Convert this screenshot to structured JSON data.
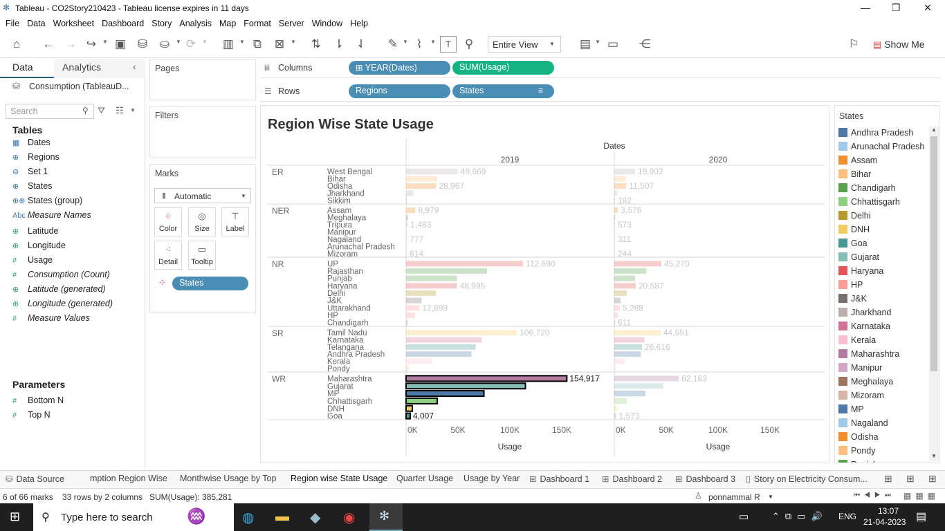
{
  "window": {
    "title": "Tableau - CO2Story210423 - Tableau license expires in 11 days",
    "min": "—",
    "max": "❐",
    "close": "✕"
  },
  "menu": [
    "File",
    "Data",
    "Worksheet",
    "Dashboard",
    "Story",
    "Analysis",
    "Map",
    "Format",
    "Server",
    "Window",
    "Help"
  ],
  "toolbar": {
    "view_select": "Entire View",
    "show_me": "Show Me"
  },
  "left": {
    "tab_data": "Data",
    "tab_analytics": "Analytics",
    "datasource": "Consumption (TableauD...",
    "search_placeholder": "Search",
    "tables_header": "Tables",
    "fields": [
      {
        "icon": "cal",
        "name": "Dates",
        "kind": "dim"
      },
      {
        "icon": "globe",
        "name": "Regions",
        "kind": "dim"
      },
      {
        "icon": "set",
        "name": "Set 1",
        "kind": "dim"
      },
      {
        "icon": "globe",
        "name": "States",
        "kind": "dim"
      },
      {
        "icon": "group",
        "name": "States (group)",
        "kind": "dim"
      },
      {
        "icon": "Abc",
        "name": "Measure Names",
        "kind": "it"
      },
      {
        "icon": "globe",
        "name": "Latitude",
        "kind": "mea"
      },
      {
        "icon": "globe",
        "name": "Longitude",
        "kind": "mea"
      },
      {
        "icon": "#",
        "name": "Usage",
        "kind": "mea"
      },
      {
        "icon": "#",
        "name": "Consumption (Count)",
        "kind": "mea-it"
      },
      {
        "icon": "globe",
        "name": "Latitude (generated)",
        "kind": "mea-it"
      },
      {
        "icon": "globe",
        "name": "Longitude (generated)",
        "kind": "mea-it"
      },
      {
        "icon": "#",
        "name": "Measure Values",
        "kind": "mea-it"
      }
    ],
    "parameters_header": "Parameters",
    "parameters": [
      "Bottom N",
      "Top N"
    ]
  },
  "cards": {
    "pages": "Pages",
    "filters": "Filters",
    "marks": "Marks",
    "mark_type": "Automatic",
    "buttons": [
      "Color",
      "Size",
      "Label",
      "Detail",
      "Tooltip"
    ],
    "color_pill": "States"
  },
  "shelves": {
    "columns_label": "Columns",
    "rows_label": "Rows",
    "columns": [
      "YEAR(Dates)",
      "SUM(Usage)"
    ],
    "rows": [
      "Regions",
      "States"
    ]
  },
  "chart_data": {
    "type": "bar",
    "title": "Region Wise State Usage",
    "column_header": "Dates",
    "panes": [
      "2019",
      "2020"
    ],
    "xlabel": "Usage",
    "xlim": [
      0,
      200000
    ],
    "x_ticks": [
      "0K",
      "50K",
      "100K",
      "150K"
    ],
    "regions": [
      {
        "name": "ER",
        "states": [
          {
            "state": "West Bengal",
            "v2019": 49869,
            "v2020": 19902,
            "l2019": "49,869",
            "l2020": "19,902"
          },
          {
            "state": "Bihar",
            "v2019": 30000,
            "v2020": 11000
          },
          {
            "state": "Odisha",
            "v2019": 28967,
            "v2020": 11507,
            "l2019": "28,967",
            "l2020": "11,507"
          },
          {
            "state": "Jharkhand",
            "v2019": 7000,
            "v2020": 2500
          },
          {
            "state": "Sikkim",
            "v2019": 500,
            "v2020": 182,
            "l2020": "182"
          }
        ]
      },
      {
        "name": "NER",
        "states": [
          {
            "state": "Assam",
            "v2019": 8979,
            "v2020": 3576,
            "l2019": "8,979",
            "l2020": "3,576"
          },
          {
            "state": "Meghalaya",
            "v2019": 1800,
            "v2020": 700
          },
          {
            "state": "Tripura",
            "v2019": 1483,
            "v2020": 573,
            "l2019": "1,483",
            "l2020": "573"
          },
          {
            "state": "Manipur",
            "v2019": 900,
            "v2020": 350
          },
          {
            "state": "Nagaland",
            "v2019": 777,
            "v2020": 311,
            "l2019": "777",
            "l2020": "311"
          },
          {
            "state": "Arunachal Pradesh",
            "v2019": 700,
            "v2020": 280
          },
          {
            "state": "Mizoram",
            "v2019": 614,
            "v2020": 244,
            "l2019": "614",
            "l2020": "244"
          }
        ]
      },
      {
        "name": "NR",
        "states": [
          {
            "state": "UP",
            "v2019": 112690,
            "v2020": 45270,
            "l2019": "112,690",
            "l2020": "45,270"
          },
          {
            "state": "Rajasthan",
            "v2019": 78000,
            "v2020": 31000
          },
          {
            "state": "Punjab",
            "v2019": 49000,
            "v2020": 20000
          },
          {
            "state": "Haryana",
            "v2019": 48995,
            "v2020": 20587,
            "l2019": "48,995",
            "l2020": "20,587"
          },
          {
            "state": "Delhi",
            "v2019": 29000,
            "v2020": 12000
          },
          {
            "state": "J&K",
            "v2019": 15000,
            "v2020": 6000
          },
          {
            "state": "Uttarakhand",
            "v2019": 12899,
            "v2020": 5288,
            "l2019": "12,899",
            "l2020": "5,288"
          },
          {
            "state": "HP",
            "v2019": 8500,
            "v2020": 3500
          },
          {
            "state": "Chandigarh",
            "v2019": 1500,
            "v2020": 611,
            "l2020": "611"
          }
        ]
      },
      {
        "name": "SR",
        "states": [
          {
            "state": "Tamil Nadu",
            "v2019": 106720,
            "v2020": 44551,
            "l2019": "106,720",
            "l2020": "44,551"
          },
          {
            "state": "Karnataka",
            "v2019": 73000,
            "v2020": 29000
          },
          {
            "state": "Telangana",
            "v2019": 67000,
            "v2020": 26616,
            "l2020": "26,616"
          },
          {
            "state": "Andhra Pradesh",
            "v2019": 63000,
            "v2020": 25500
          },
          {
            "state": "Kerala",
            "v2019": 25000,
            "v2020": 10000
          },
          {
            "state": "Pondy",
            "v2019": 2500,
            "v2020": 1000
          }
        ]
      },
      {
        "name": "WR",
        "states": [
          {
            "state": "Maharashtra",
            "v2019": 154917,
            "v2020": 62163,
            "l2019": "154,917",
            "l2020": "62,163",
            "sel": true
          },
          {
            "state": "Gujarat",
            "v2019": 115000,
            "v2020": 47000,
            "sel": true
          },
          {
            "state": "MP",
            "v2019": 75000,
            "v2020": 30000,
            "sel": true
          },
          {
            "state": "Chhattisgarh",
            "v2019": 30000,
            "v2020": 12000,
            "sel": true
          },
          {
            "state": "DNH",
            "v2019": 6000,
            "v2020": 2400,
            "sel": true
          },
          {
            "state": "Goa",
            "v2019": 4007,
            "v2020": 1573,
            "l2019": "4,007",
            "l2020": "1,573",
            "sel": true
          }
        ]
      }
    ]
  },
  "legend": {
    "title": "States",
    "items": [
      {
        "name": "Andhra Pradesh",
        "color": "#4e79a7"
      },
      {
        "name": "Arunachal Pradesh",
        "color": "#a0cbe8"
      },
      {
        "name": "Assam",
        "color": "#f28e2b"
      },
      {
        "name": "Bihar",
        "color": "#ffbe7d"
      },
      {
        "name": "Chandigarh",
        "color": "#59a14f"
      },
      {
        "name": "Chhattisgarh",
        "color": "#8cd17d"
      },
      {
        "name": "Delhi",
        "color": "#b6992d"
      },
      {
        "name": "DNH",
        "color": "#f1ce63"
      },
      {
        "name": "Goa",
        "color": "#499894"
      },
      {
        "name": "Gujarat",
        "color": "#86bcb6"
      },
      {
        "name": "Haryana",
        "color": "#e15759"
      },
      {
        "name": "HP",
        "color": "#ff9d9a"
      },
      {
        "name": "J&K",
        "color": "#79706e"
      },
      {
        "name": "Jharkhand",
        "color": "#bab0ac"
      },
      {
        "name": "Karnataka",
        "color": "#d37295"
      },
      {
        "name": "Kerala",
        "color": "#fabfd2"
      },
      {
        "name": "Maharashtra",
        "color": "#b07aa1"
      },
      {
        "name": "Manipur",
        "color": "#d4a6c8"
      },
      {
        "name": "Meghalaya",
        "color": "#9d7660"
      },
      {
        "name": "Mizoram",
        "color": "#d7b5a6"
      },
      {
        "name": "MP",
        "color": "#4e79a7"
      },
      {
        "name": "Nagaland",
        "color": "#a0cbe8"
      },
      {
        "name": "Odisha",
        "color": "#f28e2b"
      },
      {
        "name": "Pondy",
        "color": "#ffbe7d"
      },
      {
        "name": "Punjab",
        "color": "#59a14f"
      }
    ]
  },
  "sheet_tabs": [
    {
      "label": "Data Source",
      "icon": "db"
    },
    {
      "label": "mption Region Wise",
      "icon": ""
    },
    {
      "label": "Monthwise Usage by Top",
      "icon": ""
    },
    {
      "label": "Region wise State Usage",
      "icon": "",
      "active": true
    },
    {
      "label": "Quarter Usage",
      "icon": ""
    },
    {
      "label": "Usage by Year",
      "icon": ""
    },
    {
      "label": "Dashboard 1",
      "icon": "dash"
    },
    {
      "label": "Dashboard 2",
      "icon": "dash"
    },
    {
      "label": "Dashboard 3",
      "icon": "dash"
    },
    {
      "label": "Story on Electricity Consum...",
      "icon": "story"
    }
  ],
  "status": {
    "marks": "6 of 66 marks",
    "rows": "33 rows by 2 columns",
    "sum": "SUM(Usage): 385,281",
    "user": "ponnammal R"
  },
  "taskbar": {
    "search": "Type here to search",
    "lang": "ENG",
    "time": "13:07",
    "date": "21-04-2023"
  }
}
